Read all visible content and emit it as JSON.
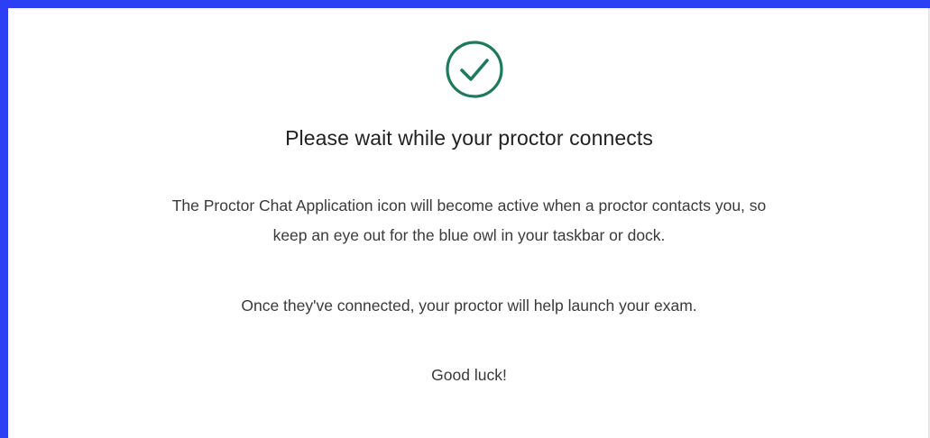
{
  "colors": {
    "frame_border": "#2b3ff5",
    "check_green": "#1f7a5c",
    "text_dark": "#222222",
    "text_body": "#3a3a3a",
    "background": "#ffffff"
  },
  "status": {
    "icon": "check-circle-icon",
    "title": "Please wait while your proctor connects"
  },
  "message": {
    "line1": "The Proctor Chat Application icon will become active when a proctor contacts you, so",
    "line2": "keep an eye out for the blue owl in your taskbar or dock.",
    "line3": "Once they've connected, your proctor will help launch your exam.",
    "line4": "Good luck!"
  }
}
